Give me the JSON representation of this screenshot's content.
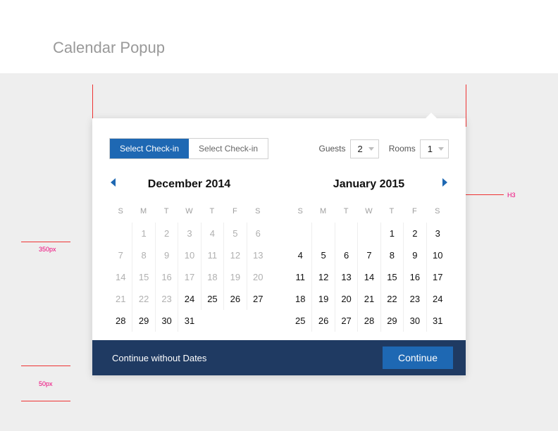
{
  "page_title": "Calendar Popup",
  "annotations": {
    "h3_label": "H3",
    "dim_350": "350px",
    "dim_50": "50px"
  },
  "popup": {
    "tabs": {
      "checkin": "Select Check-in",
      "checkout": "Select Check-in"
    },
    "guests": {
      "label": "Guests",
      "value": "2"
    },
    "rooms": {
      "label": "Rooms",
      "value": "1"
    },
    "dow": [
      "S",
      "M",
      "T",
      "W",
      "T",
      "F",
      "S"
    ],
    "month_left": {
      "title": "December 2014",
      "lead_blank": 1,
      "days": 31,
      "disabled_through": 23
    },
    "month_right": {
      "title": "January 2015",
      "lead_blank": 4,
      "days": 31,
      "disabled_through": 0
    },
    "footer": {
      "no_dates": "Continue without Dates",
      "continue": "Continue"
    }
  }
}
